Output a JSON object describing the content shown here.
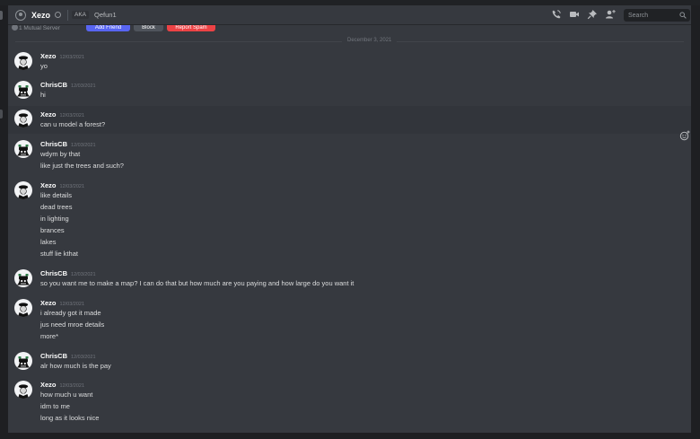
{
  "header": {
    "title": "Xezo",
    "aka_label": "AKA",
    "alias": "Qefun1",
    "search_placeholder": "Search"
  },
  "profile": {
    "mutual_server": "1 Mutual Server",
    "add_friend": "Add Friend",
    "block": "Block",
    "report_spam": "Report Spam"
  },
  "day_divider": "December 3, 2021",
  "colors": {
    "add_friend": "#5865f2",
    "block": "#4f545c",
    "report_spam": "#ed4245",
    "background": "#36393f"
  },
  "messages": [
    {
      "author": "Xezo",
      "timestamp": "12/03/2021",
      "lines": [
        "yo"
      ]
    },
    {
      "author": "ChrisCB",
      "timestamp": "12/03/2021",
      "lines": [
        "hi"
      ]
    },
    {
      "author": "Xezo",
      "timestamp": "12/03/2021",
      "lines": [
        "can u model a forest?"
      ]
    },
    {
      "author": "ChrisCB",
      "timestamp": "12/03/2021",
      "lines": [
        "wdym by that",
        "like just the trees and such?"
      ]
    },
    {
      "author": "Xezo",
      "timestamp": "12/03/2021",
      "lines": [
        "like details",
        "dead trees",
        "in lighting",
        "brances",
        "lakes",
        "stuff lie kthat"
      ]
    },
    {
      "author": "ChrisCB",
      "timestamp": "12/03/2021",
      "lines": [
        "so you want me to make a map? I can do that but how much are you paying and how large do you want it"
      ]
    },
    {
      "author": "Xezo",
      "timestamp": "12/03/2021",
      "lines": [
        "i already got it made",
        "jus need mroe details",
        "more*"
      ]
    },
    {
      "author": "ChrisCB",
      "timestamp": "12/03/2021",
      "lines": [
        "alr how much is the pay"
      ]
    },
    {
      "author": "Xezo",
      "timestamp": "12/03/2021",
      "lines": [
        "how much u want",
        "idm to me",
        "long as it looks nice"
      ]
    }
  ]
}
